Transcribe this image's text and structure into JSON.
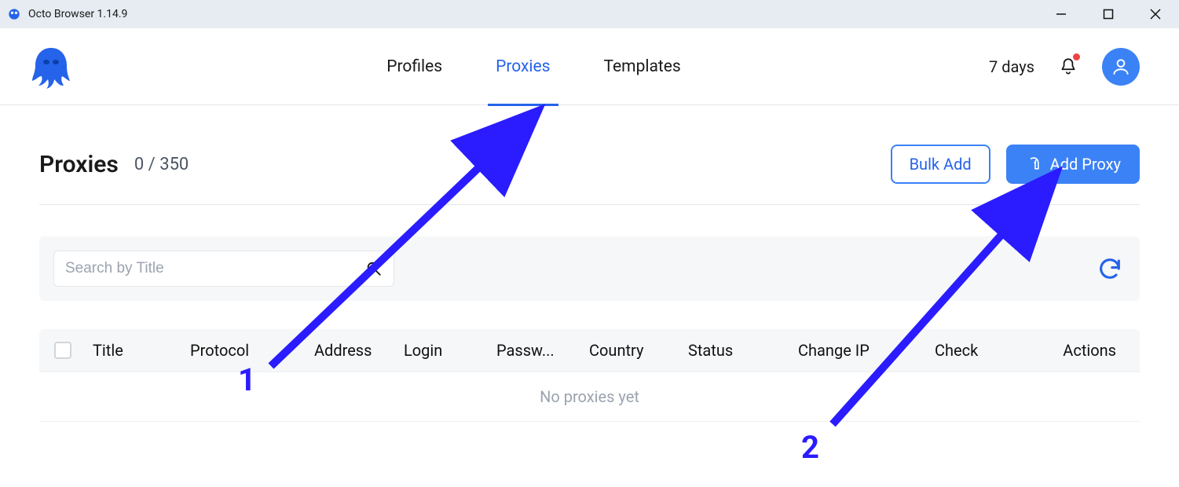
{
  "window": {
    "title": "Octo Browser 1.14.9"
  },
  "nav": {
    "profiles": "Profiles",
    "proxies": "Proxies",
    "templates": "Templates",
    "days": "7 days"
  },
  "page": {
    "title": "Proxies",
    "counter": "0 / 350",
    "bulk_add": "Bulk Add",
    "add_proxy": "Add Proxy",
    "search_placeholder": "Search by Title",
    "empty": "No proxies yet"
  },
  "columns": {
    "title": "Title",
    "protocol": "Protocol",
    "address": "Address",
    "login": "Login",
    "password": "Passw...",
    "country": "Country",
    "status": "Status",
    "changeip": "Change IP",
    "check": "Check",
    "actions": "Actions"
  },
  "annotations": {
    "one": "1",
    "two": "2"
  }
}
